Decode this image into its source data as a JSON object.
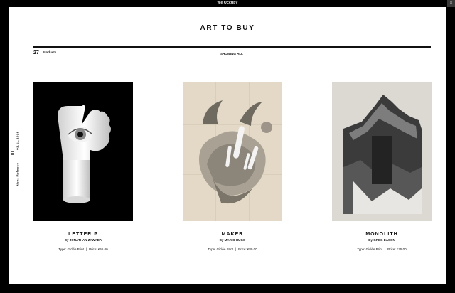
{
  "topbar": {
    "brand": "We Occupy",
    "corner_icon": "close-icon"
  },
  "page": {
    "title": "ART TO BUY"
  },
  "toolbar": {
    "count": "27",
    "count_label": "Products",
    "filter_label": "SHOWING ALL"
  },
  "side": {
    "release_label": "Next Release",
    "release_date": "01.11.2016",
    "menu_icon": "menu-icon"
  },
  "products": [
    {
      "name": "LETTER P",
      "artist": "By JONATHAN ZAWADA",
      "type": "Type: Giclée Print",
      "price": "Price: €55.00"
    },
    {
      "name": "MAKER",
      "artist": "By MARIO HUGO",
      "type": "Type: Giclée Print",
      "price": "Price: €80.00"
    },
    {
      "name": "MONOLITH",
      "artist": "By GREG EASON",
      "type": "Type: Giclée Print",
      "price": "Price: £75.00"
    }
  ],
  "colors": {
    "background": "#000000",
    "frame": "#ffffff",
    "text": "#111111"
  }
}
